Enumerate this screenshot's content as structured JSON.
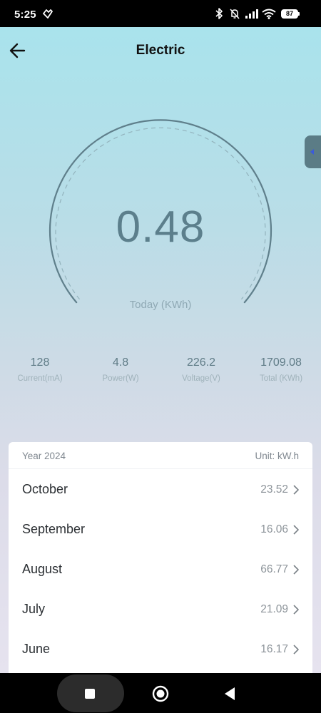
{
  "status_bar": {
    "time": "5:25",
    "battery": "87",
    "icons": [
      "app-notification-icon",
      "bluetooth-icon",
      "silent-bell-icon",
      "signal-icon",
      "wifi-icon",
      "battery-icon"
    ]
  },
  "header": {
    "title": "Electric",
    "back_icon": "arrow-left-icon"
  },
  "gauge": {
    "value": "0.48",
    "label": "Today (KWh)",
    "colors": {
      "arc": "#5f7f8b",
      "text": "#5c7f8c"
    }
  },
  "stats": [
    {
      "value": "128",
      "label": "Current(mA)"
    },
    {
      "value": "4.8",
      "label": "Power(W)"
    },
    {
      "value": "226.2",
      "label": "Voltage(V)"
    },
    {
      "value": "1709.08",
      "label": "Total (KWh)"
    }
  ],
  "monthly": {
    "year_label": "Year 2024",
    "unit_label": "Unit: kW.h",
    "months": [
      {
        "name": "October",
        "value": "23.52"
      },
      {
        "name": "September",
        "value": "16.06"
      },
      {
        "name": "August",
        "value": "66.77"
      },
      {
        "name": "July",
        "value": "21.09"
      },
      {
        "name": "June",
        "value": "16.17"
      }
    ]
  },
  "nav": {
    "icons": [
      "recents-square-icon",
      "home-circle-icon",
      "back-triangle-icon"
    ]
  },
  "colors": {
    "bg_top": "#a9e3ec",
    "bg_bottom": "#e6e3ef",
    "handle": "#5b7c86",
    "handle_arrow": "#3b5bdb"
  }
}
